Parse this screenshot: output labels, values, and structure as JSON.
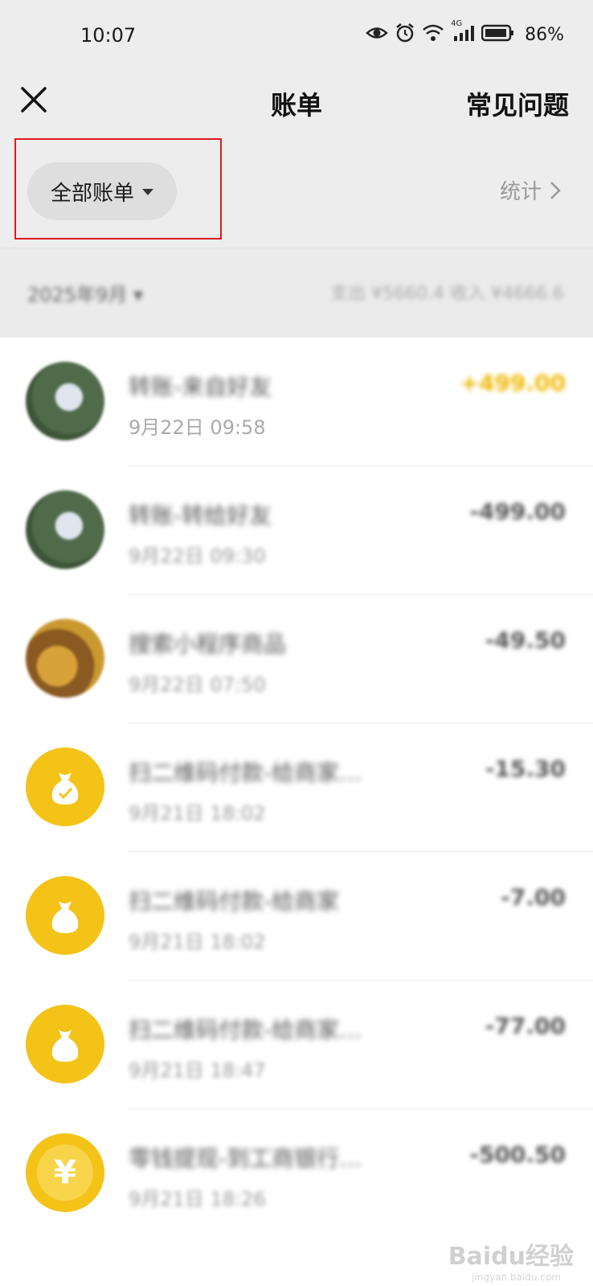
{
  "status_bar": {
    "time": "10:07",
    "network": "4G",
    "battery": "86%"
  },
  "header": {
    "title": "账单",
    "faq_label": "常见问题"
  },
  "filter": {
    "selected": "全部账单",
    "stats_label": "统计"
  },
  "month": {
    "label": "2025年9月",
    "summary": "支出 ¥5660.4 收入 ¥4666.6"
  },
  "transactions": [
    {
      "name": "转账-来自好友",
      "time": "9月22日 09:58",
      "amount": "+499.00",
      "avatar": "photo"
    },
    {
      "name": "转账-转给好友",
      "time": "9月22日 09:30",
      "amount": "-499.00",
      "avatar": "photo"
    },
    {
      "name": "搜索小程序商品",
      "time": "9月22日 07:50",
      "amount": "-49.50",
      "avatar": "photo-food"
    },
    {
      "name": "扫二维码付款-给商家…",
      "time": "9月21日 18:02",
      "amount": "-15.30",
      "avatar": "money-bag-icon"
    },
    {
      "name": "扫二维码付款-给商家",
      "time": "9月21日 18:02",
      "amount": "-7.00",
      "avatar": "money-bag-icon"
    },
    {
      "name": "扫二维码付款-给商家…",
      "time": "9月21日 18:47",
      "amount": "-77.00",
      "avatar": "money-bag-icon"
    },
    {
      "name": "零钱提现-到工商银行…",
      "time": "9月21日 18:26",
      "amount": "-500.50",
      "avatar": "yen-coin-icon"
    }
  ],
  "watermark": {
    "text": "Baidu经验",
    "url": "jingyan.baidu.com"
  },
  "colors": {
    "income": "#f0b800",
    "highlight_border": "#e0191e",
    "avatar_yellow": "#f3c318"
  }
}
